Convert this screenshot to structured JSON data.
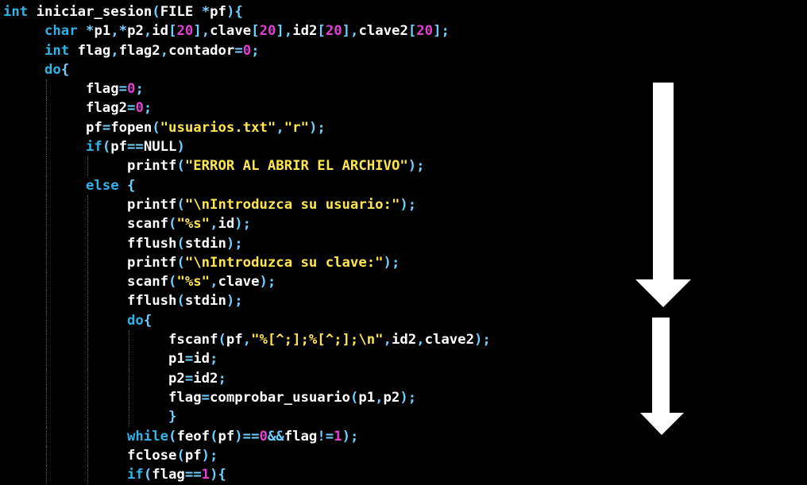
{
  "code": {
    "lines": [
      {
        "indent": 0,
        "tokens": [
          [
            "kw",
            "int"
          ],
          [
            "id",
            " iniciar_sesion"
          ],
          [
            "op",
            "("
          ],
          [
            "id",
            "FILE "
          ],
          [
            "op",
            "*"
          ],
          [
            "id",
            "pf"
          ],
          [
            "op",
            ")"
          ],
          [
            "op",
            "{"
          ]
        ]
      },
      {
        "indent": 1,
        "tokens": [
          [
            "kw",
            "char"
          ],
          [
            "id",
            " "
          ],
          [
            "op",
            "*"
          ],
          [
            "id",
            "p1"
          ],
          [
            "op",
            ",*"
          ],
          [
            "id",
            "p2"
          ],
          [
            "op",
            ","
          ],
          [
            "id",
            "id"
          ],
          [
            "op",
            "["
          ],
          [
            "num",
            "20"
          ],
          [
            "op",
            "],"
          ],
          [
            "id",
            "clave"
          ],
          [
            "op",
            "["
          ],
          [
            "num",
            "20"
          ],
          [
            "op",
            "],"
          ],
          [
            "id",
            "id2"
          ],
          [
            "op",
            "["
          ],
          [
            "num",
            "20"
          ],
          [
            "op",
            "],"
          ],
          [
            "id",
            "clave2"
          ],
          [
            "op",
            "["
          ],
          [
            "num",
            "20"
          ],
          [
            "op",
            "];"
          ]
        ]
      },
      {
        "indent": 1,
        "tokens": [
          [
            "kw",
            "int"
          ],
          [
            "id",
            " flag"
          ],
          [
            "op",
            ","
          ],
          [
            "id",
            "flag2"
          ],
          [
            "op",
            ","
          ],
          [
            "id",
            "contador"
          ],
          [
            "op",
            "="
          ],
          [
            "num",
            "0"
          ],
          [
            "op",
            ";"
          ]
        ]
      },
      {
        "indent": 1,
        "tokens": [
          [
            "kw",
            "do"
          ],
          [
            "op",
            "{"
          ]
        ]
      },
      {
        "indent": 2,
        "tokens": [
          [
            "id",
            "flag"
          ],
          [
            "op",
            "="
          ],
          [
            "num",
            "0"
          ],
          [
            "op",
            ";"
          ]
        ]
      },
      {
        "indent": 2,
        "tokens": [
          [
            "id",
            "flag2"
          ],
          [
            "op",
            "="
          ],
          [
            "num",
            "0"
          ],
          [
            "op",
            ";"
          ]
        ]
      },
      {
        "indent": 2,
        "tokens": [
          [
            "id",
            "pf"
          ],
          [
            "op",
            "="
          ],
          [
            "fn",
            "fopen"
          ],
          [
            "op",
            "("
          ],
          [
            "str",
            "\"usuarios.txt\""
          ],
          [
            "op",
            ","
          ],
          [
            "str",
            "\"r\""
          ],
          [
            "op",
            ");"
          ]
        ]
      },
      {
        "indent": 2,
        "tokens": [
          [
            "kw",
            "if"
          ],
          [
            "op",
            "("
          ],
          [
            "id",
            "pf"
          ],
          [
            "op",
            "=="
          ],
          [
            "id",
            "NULL"
          ],
          [
            "op",
            ")"
          ]
        ]
      },
      {
        "indent": 3,
        "tokens": [
          [
            "fn",
            "printf"
          ],
          [
            "op",
            "("
          ],
          [
            "str",
            "\"ERROR AL ABRIR EL ARCHIVO\""
          ],
          [
            "op",
            ");"
          ]
        ]
      },
      {
        "indent": 2,
        "tokens": [
          [
            "kw",
            "else"
          ],
          [
            "id",
            " "
          ],
          [
            "op",
            "{"
          ]
        ]
      },
      {
        "indent": 3,
        "tokens": [
          [
            "fn",
            "printf"
          ],
          [
            "op",
            "("
          ],
          [
            "str",
            "\"\\nIntroduzca su usuario:\""
          ],
          [
            "op",
            ");"
          ]
        ]
      },
      {
        "indent": 3,
        "tokens": [
          [
            "fn",
            "scanf"
          ],
          [
            "op",
            "("
          ],
          [
            "str",
            "\"%s\""
          ],
          [
            "op",
            ","
          ],
          [
            "id",
            "id"
          ],
          [
            "op",
            ");"
          ]
        ]
      },
      {
        "indent": 3,
        "tokens": [
          [
            "fn",
            "fflush"
          ],
          [
            "op",
            "("
          ],
          [
            "id",
            "stdin"
          ],
          [
            "op",
            ");"
          ]
        ]
      },
      {
        "indent": 3,
        "tokens": [
          [
            "fn",
            "printf"
          ],
          [
            "op",
            "("
          ],
          [
            "str",
            "\"\\nIntroduzca su clave:\""
          ],
          [
            "op",
            ");"
          ]
        ]
      },
      {
        "indent": 3,
        "tokens": [
          [
            "fn",
            "scanf"
          ],
          [
            "op",
            "("
          ],
          [
            "str",
            "\"%s\""
          ],
          [
            "op",
            ","
          ],
          [
            "id",
            "clave"
          ],
          [
            "op",
            ");"
          ]
        ]
      },
      {
        "indent": 3,
        "tokens": [
          [
            "fn",
            "fflush"
          ],
          [
            "op",
            "("
          ],
          [
            "id",
            "stdin"
          ],
          [
            "op",
            ");"
          ]
        ]
      },
      {
        "indent": 3,
        "tokens": [
          [
            "kw",
            "do"
          ],
          [
            "op",
            "{"
          ]
        ]
      },
      {
        "indent": 4,
        "tokens": [
          [
            "fn",
            "fscanf"
          ],
          [
            "op",
            "("
          ],
          [
            "id",
            "pf"
          ],
          [
            "op",
            ","
          ],
          [
            "str",
            "\"%[^;];%[^;];\\n\""
          ],
          [
            "op",
            ","
          ],
          [
            "id",
            "id2"
          ],
          [
            "op",
            ","
          ],
          [
            "id",
            "clave2"
          ],
          [
            "op",
            ");"
          ]
        ]
      },
      {
        "indent": 4,
        "tokens": [
          [
            "id",
            "p1"
          ],
          [
            "op",
            "="
          ],
          [
            "id",
            "id"
          ],
          [
            "op",
            ";"
          ]
        ]
      },
      {
        "indent": 4,
        "tokens": [
          [
            "id",
            "p2"
          ],
          [
            "op",
            "="
          ],
          [
            "id",
            "id2"
          ],
          [
            "op",
            ";"
          ]
        ]
      },
      {
        "indent": 4,
        "tokens": [
          [
            "id",
            "flag"
          ],
          [
            "op",
            "="
          ],
          [
            "fn",
            "comprobar_usuario"
          ],
          [
            "op",
            "("
          ],
          [
            "id",
            "p1"
          ],
          [
            "op",
            ","
          ],
          [
            "id",
            "p2"
          ],
          [
            "op",
            ");"
          ]
        ]
      },
      {
        "indent": 4,
        "tokens": [
          [
            "op",
            "}"
          ]
        ]
      },
      {
        "indent": 3,
        "tokens": [
          [
            "kw",
            "while"
          ],
          [
            "op",
            "("
          ],
          [
            "fn",
            "feof"
          ],
          [
            "op",
            "("
          ],
          [
            "id",
            "pf"
          ],
          [
            "op",
            ")=="
          ],
          [
            "num",
            "0"
          ],
          [
            "op",
            "&&"
          ],
          [
            "id",
            "flag"
          ],
          [
            "op",
            "!="
          ],
          [
            "num",
            "1"
          ],
          [
            "op",
            ");"
          ]
        ]
      },
      {
        "indent": 3,
        "tokens": [
          [
            "fn",
            "fclose"
          ],
          [
            "op",
            "("
          ],
          [
            "id",
            "pf"
          ],
          [
            "op",
            ");"
          ]
        ]
      },
      {
        "indent": 3,
        "tokens": [
          [
            "kw",
            "if"
          ],
          [
            "op",
            "("
          ],
          [
            "id",
            "flag"
          ],
          [
            "op",
            "=="
          ],
          [
            "num",
            "1"
          ],
          [
            "op",
            "){"
          ]
        ]
      }
    ]
  },
  "annotations": {
    "arrow_color": "#ffffff",
    "arrows": [
      "down-arrow-long",
      "down-arrow-short"
    ]
  }
}
